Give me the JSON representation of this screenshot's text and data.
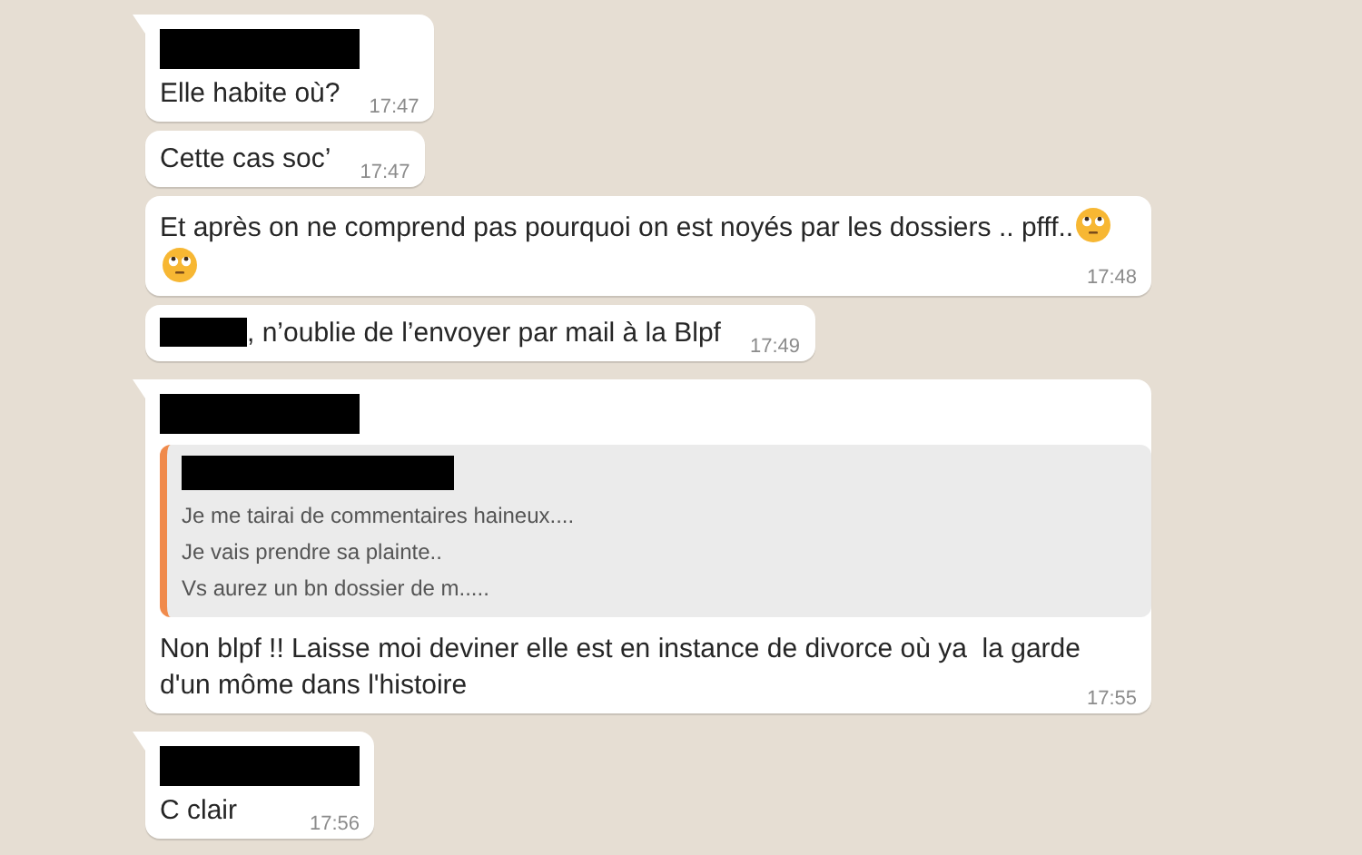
{
  "messages": [
    {
      "tail": true,
      "redacted_sender": true,
      "parts": [
        {
          "kind": "text",
          "text": "Elle habite où?"
        }
      ],
      "time": "17:47"
    },
    {
      "tail": false,
      "redacted_sender": false,
      "parts": [
        {
          "kind": "text",
          "text": "Cette cas soc’"
        }
      ],
      "time": "17:47"
    },
    {
      "tail": false,
      "redacted_sender": false,
      "parts": [
        {
          "kind": "text",
          "text": "Et après on ne comprend pas pourquoi on est noyés par les dossiers .. pfff.."
        },
        {
          "kind": "emoji"
        },
        {
          "kind": "emoji"
        }
      ],
      "time": "17:48"
    },
    {
      "tail": false,
      "redacted_sender": false,
      "parts": [
        {
          "kind": "redaction"
        },
        {
          "kind": "text",
          "text": ", n’oublie de l’envoyer par mail à la Blpf"
        }
      ],
      "time": "17:49"
    },
    {
      "tail": true,
      "redacted_sender": true,
      "quote": {
        "redacted_sender": true,
        "lines": [
          "Je me tairai de commentaires haineux....",
          "Je vais prendre sa plainte..",
          "Vs aurez un bn dossier de m....."
        ]
      },
      "parts": [
        {
          "kind": "text",
          "text": "Non blpf !! Laisse moi deviner elle est en instance de divorce où ya  la garde d'un môme dans l'histoire"
        }
      ],
      "time": "17:55"
    },
    {
      "tail": true,
      "redacted_sender": true,
      "parts": [
        {
          "kind": "text",
          "text": "C clair"
        }
      ],
      "time": "17:56"
    }
  ]
}
